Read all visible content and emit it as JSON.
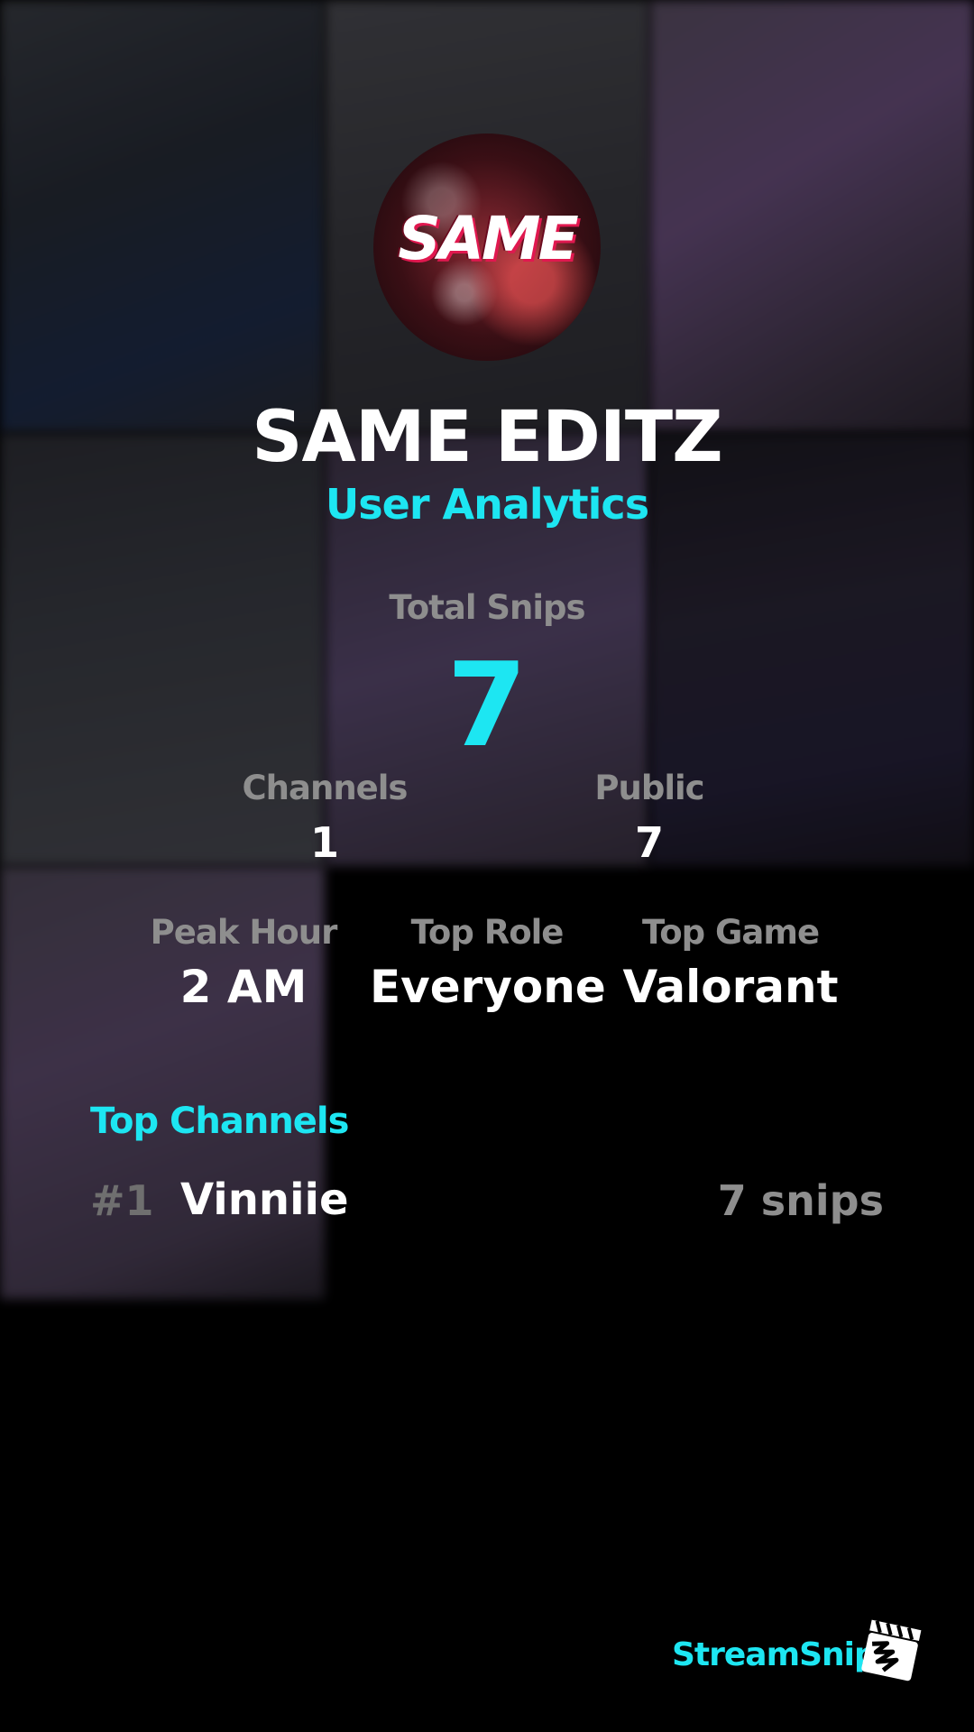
{
  "profile": {
    "name": "SAME EDITZ",
    "subtitle": "User Analytics",
    "avatar_text": "SAME"
  },
  "stats": {
    "total_snips_label": "Total Snips",
    "total_snips_value": "7",
    "channels_label": "Channels",
    "channels_value": "1",
    "public_label": "Public",
    "public_value": "7",
    "peak_hour_label": "Peak Hour",
    "peak_hour_value": "2 AM",
    "top_role_label": "Top Role",
    "top_role_value": "Everyone",
    "top_game_label": "Top Game",
    "top_game_value": "Valorant"
  },
  "top_channels": {
    "heading": "Top Channels",
    "items": [
      {
        "rank": "#1",
        "name": "Vinniie",
        "count": "7 snips"
      }
    ]
  },
  "footer": {
    "brand": "StreamSnip",
    "logo_icon": "clapperboard-icon"
  },
  "colors": {
    "accent": "#1de6f2",
    "background": "#000000",
    "label_gray": "#8e8e8e"
  }
}
